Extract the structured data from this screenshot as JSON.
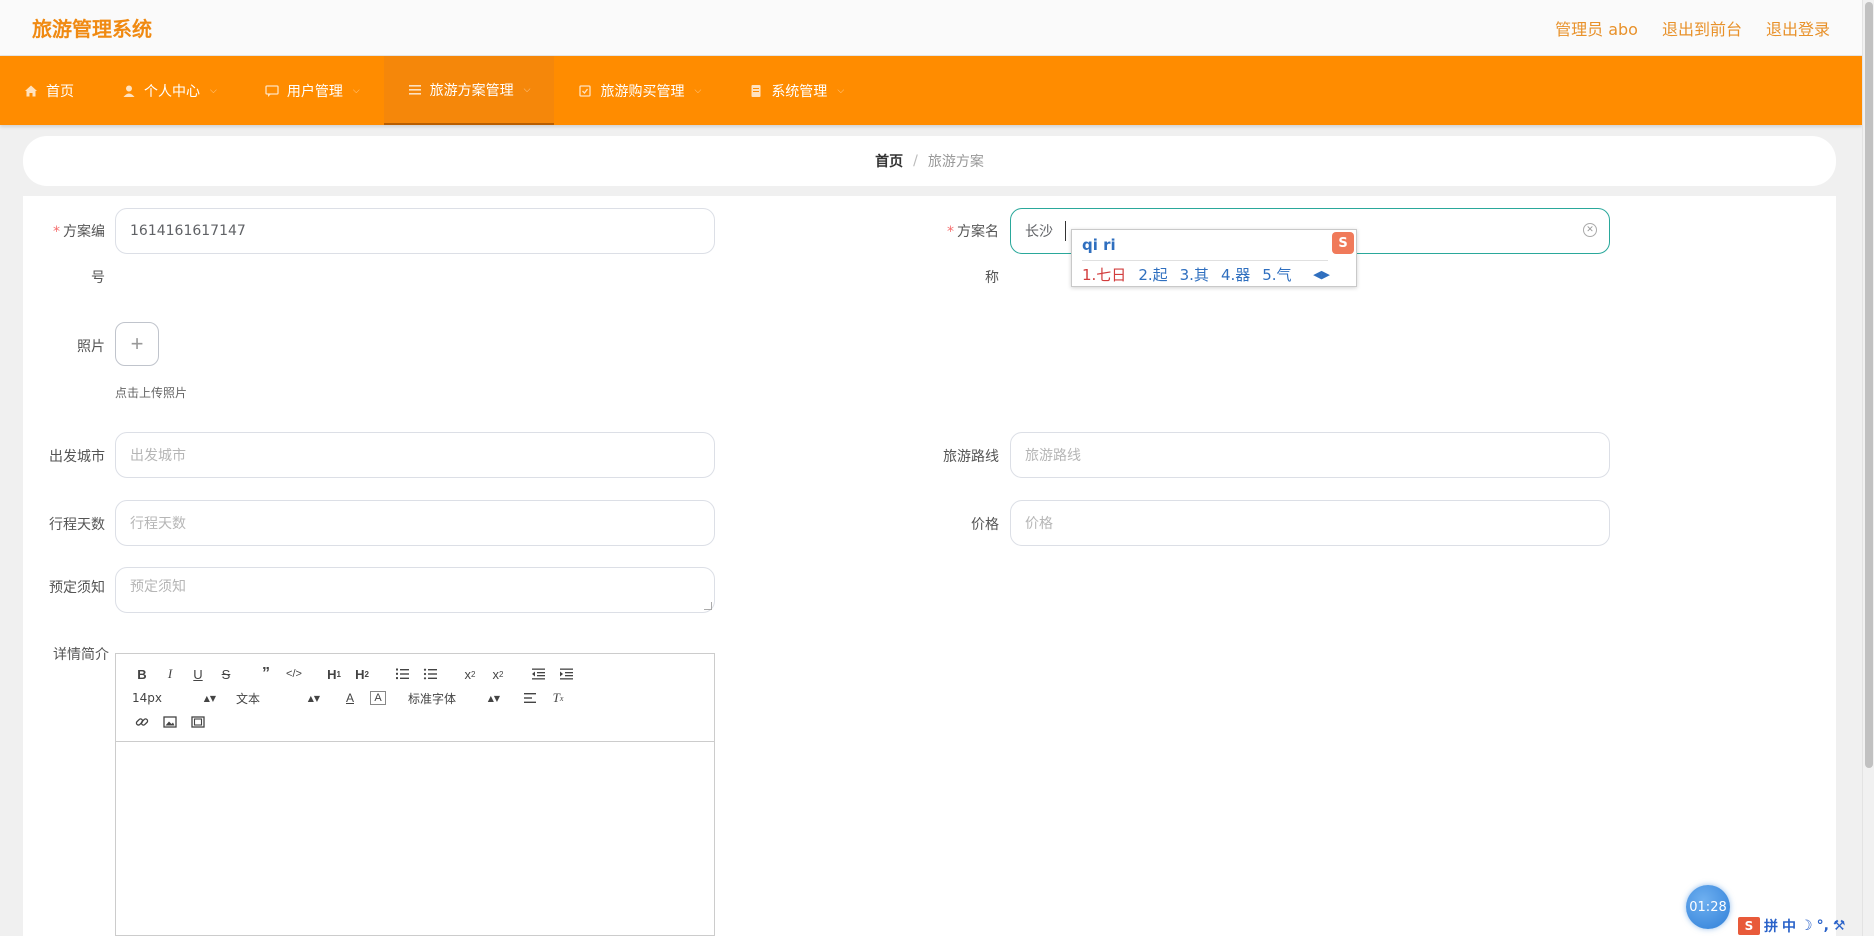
{
  "header": {
    "app_title": "旅游管理系统",
    "links": [
      "管理员 abo",
      "退出到前台",
      "退出登录"
    ]
  },
  "nav": {
    "items": [
      {
        "label": "首页",
        "icon": "home-icon"
      },
      {
        "label": "个人中心",
        "icon": "user-icon"
      },
      {
        "label": "用户管理",
        "icon": "chat-icon"
      },
      {
        "label": "旅游方案管理",
        "icon": "list-icon",
        "active": true
      },
      {
        "label": "旅游购买管理",
        "icon": "cart-icon"
      },
      {
        "label": "系统管理",
        "icon": "doc-icon"
      }
    ]
  },
  "breadcrumb": {
    "home": "首页",
    "separator": "/",
    "current": "旅游方案"
  },
  "form": {
    "plan_no": {
      "label_line1": "方案编",
      "label_line2": "号",
      "value": "1614161617147"
    },
    "plan_name": {
      "label_line1": "方案名",
      "label_line2": "称",
      "value": "长沙"
    },
    "photo": {
      "label": "照片",
      "upload_symbol": "+",
      "tip": "点击上传照片"
    },
    "depart_city": {
      "label": "出发城市",
      "placeholder": "出发城市"
    },
    "route": {
      "label": "旅游路线",
      "placeholder": "旅游路线"
    },
    "days": {
      "label": "行程天数",
      "placeholder": "行程天数"
    },
    "price": {
      "label": "价格",
      "placeholder": "价格"
    },
    "notice": {
      "label": "预定须知",
      "placeholder": "预定须知"
    },
    "intro": {
      "label": "详情简介"
    }
  },
  "editor": {
    "font_size": "14px",
    "heading": "文本",
    "font_family": "标准字体"
  },
  "ime": {
    "pinyin": "qi ri",
    "candidates": [
      "1.七日",
      "2.起",
      "3.其",
      "4.器",
      "5.气"
    ],
    "logo": "S"
  },
  "timer": "01:28",
  "tray": {
    "logo": "S",
    "items": [
      "拼",
      "中",
      "☽",
      "°,",
      "⚒"
    ]
  },
  "colors": {
    "accent": "#ff8c00",
    "title": "#f08a12",
    "focus": "#2aa89b"
  }
}
